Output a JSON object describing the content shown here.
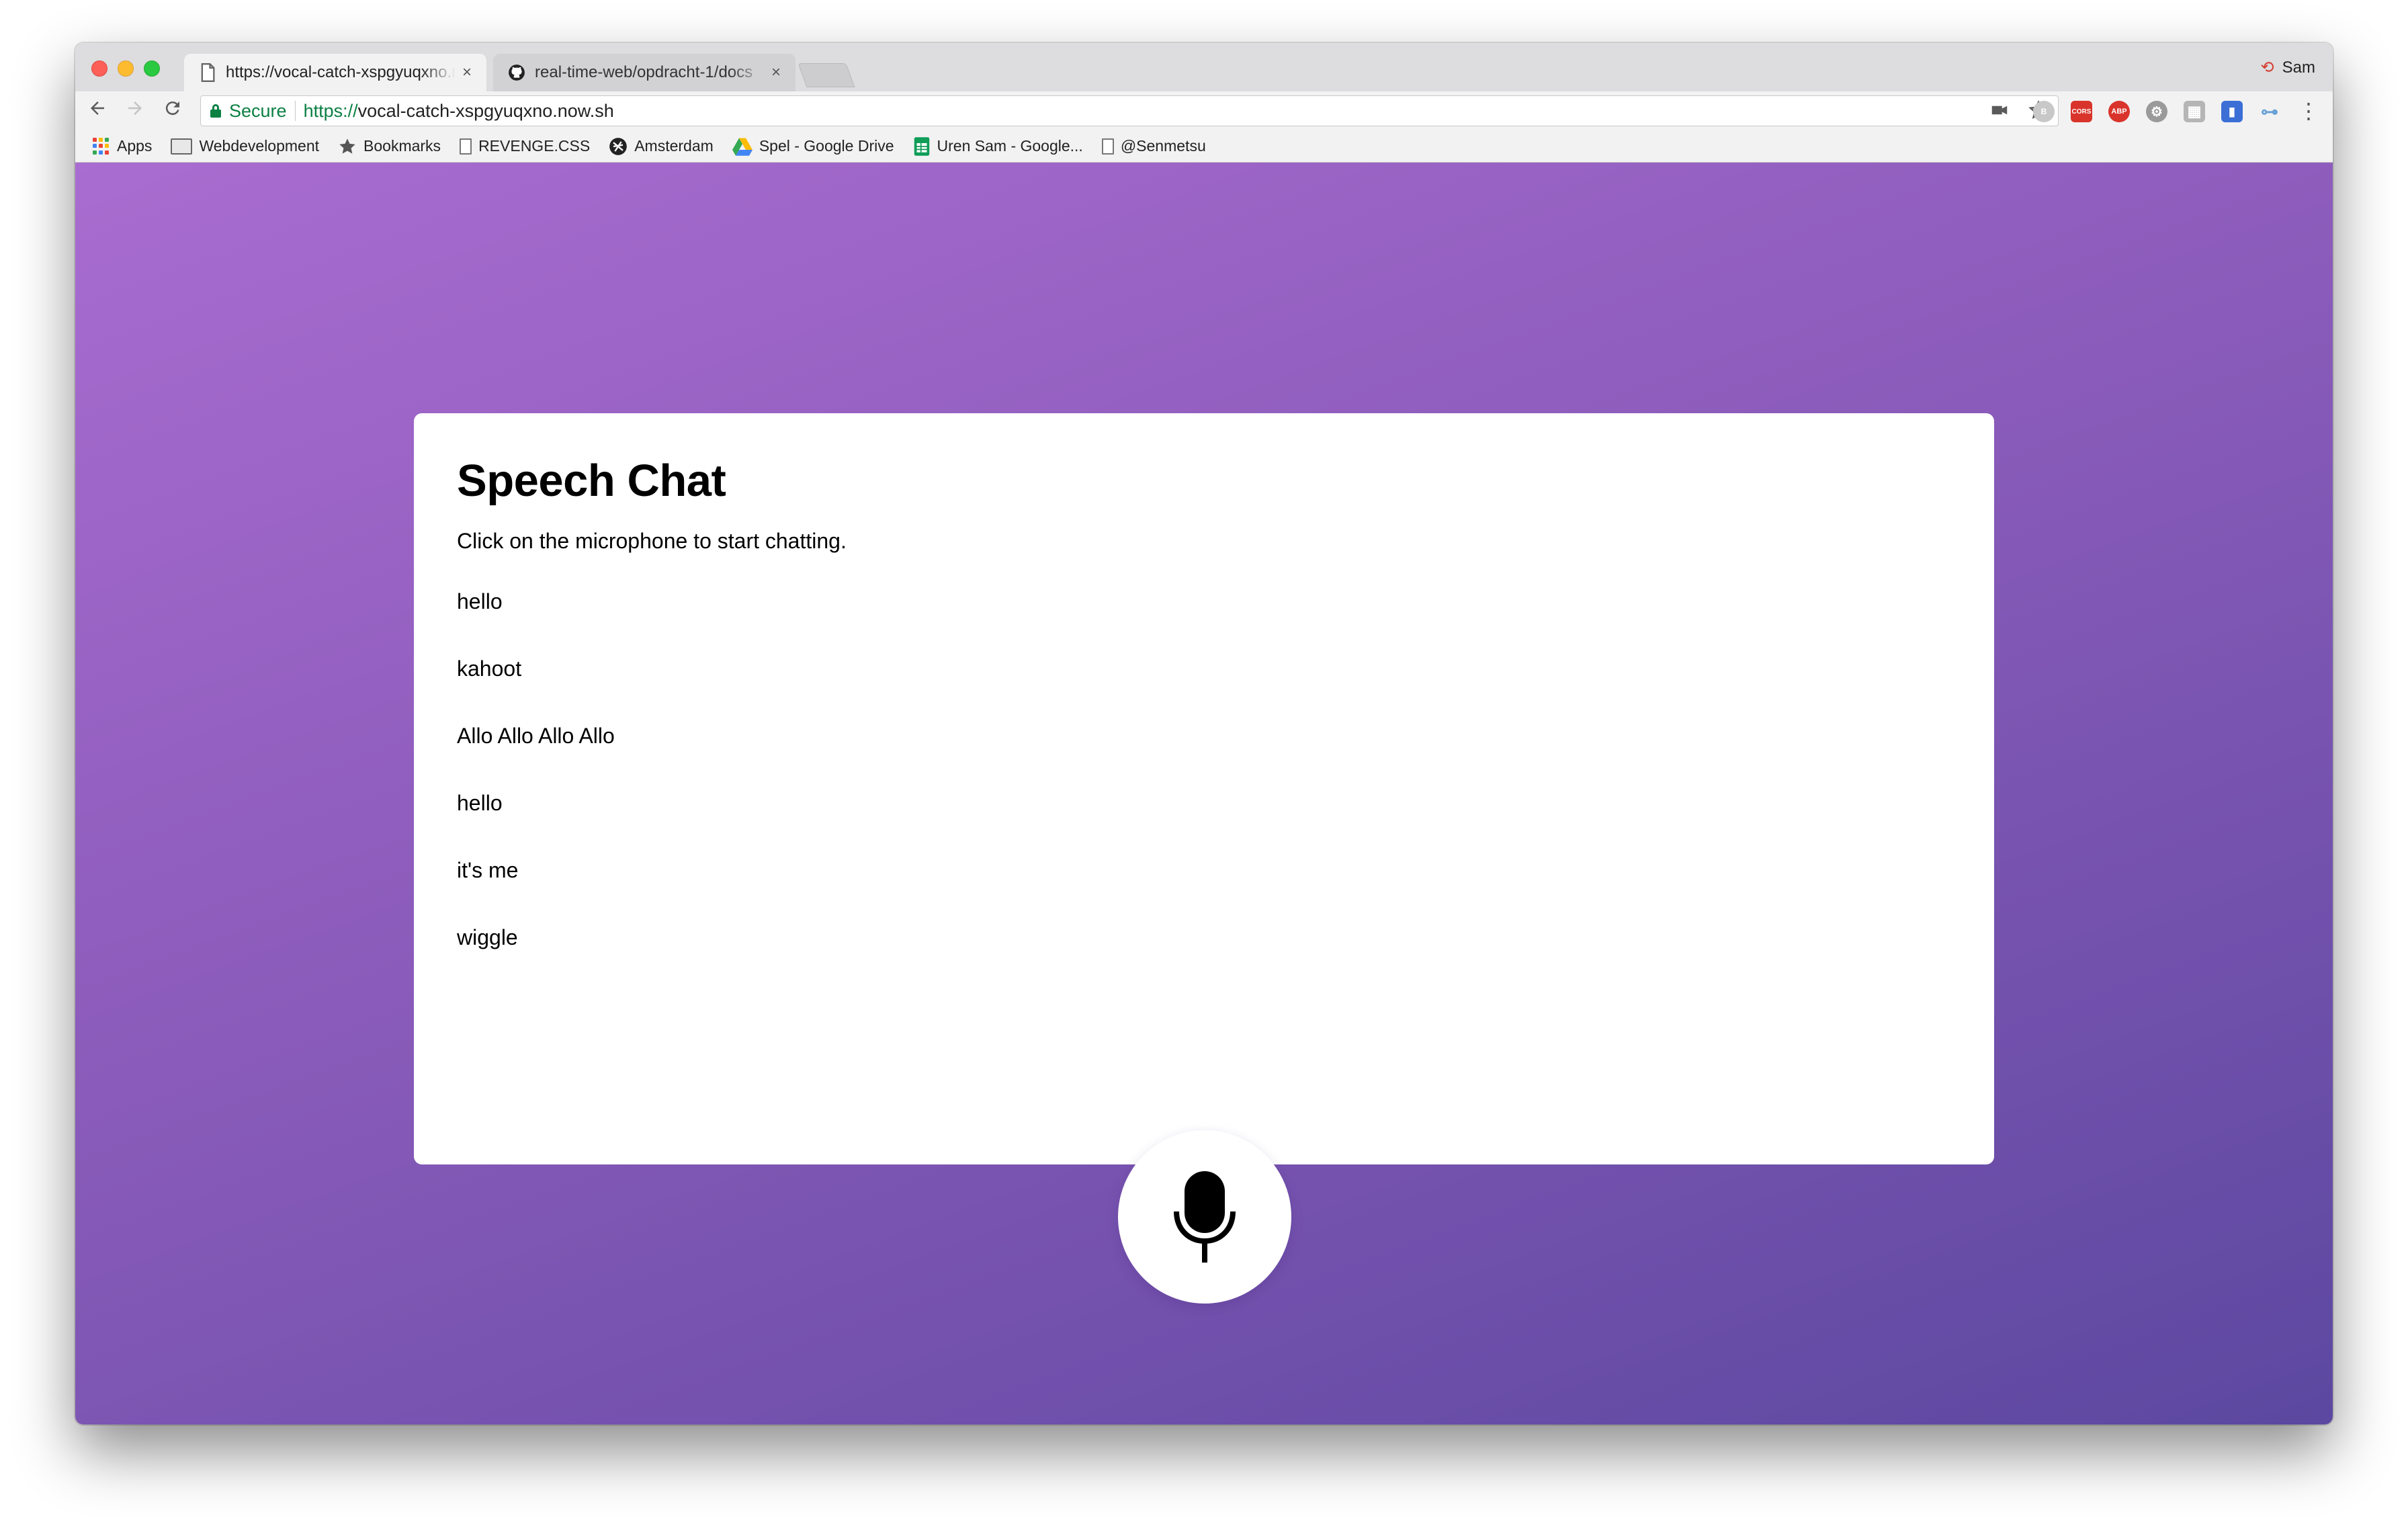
{
  "browser": {
    "tabs": [
      {
        "title": "https://vocal-catch-xspgyuqxno.now.sh",
        "active": true,
        "icon": "page-icon"
      },
      {
        "title": "real-time-web/opdracht-1/docs",
        "active": false,
        "icon": "github-icon"
      }
    ],
    "close_glyph": "×",
    "profile_name": "Sam",
    "omnibox": {
      "secure_label": "Secure",
      "url_scheme": "https://",
      "url_rest": "vocal-catch-xspgyuqxno.now.sh"
    },
    "extensions": [
      {
        "name": "bitdefender-extension-icon",
        "label": "B",
        "color": "#c8c8c8"
      },
      {
        "name": "cors-extension-icon",
        "label": "CORS",
        "color": "#d9342b"
      },
      {
        "name": "adblock-plus-icon",
        "label": "ABP",
        "color": "#d9342b"
      },
      {
        "name": "settings-extension-icon",
        "label": "⚙",
        "color": "#9a9a9a"
      },
      {
        "name": "qr-code-extension-icon",
        "label": "▦",
        "color": "#b5b5b5"
      },
      {
        "name": "blue-extension-icon",
        "label": "▮",
        "color": "#3b6fd6"
      },
      {
        "name": "toggle-extension-icon",
        "label": "⊶",
        "color": "#6aa1d6"
      }
    ],
    "bookmarks": [
      {
        "label": "Apps",
        "icon": "apps-grid-icon"
      },
      {
        "label": "Webdevelopment",
        "icon": "folder-icon"
      },
      {
        "label": "Bookmarks",
        "icon": "star-icon"
      },
      {
        "label": "REVENGE.CSS",
        "icon": "page-icon"
      },
      {
        "label": "Amsterdam",
        "icon": "amsterdam-icon"
      },
      {
        "label": "Spel - Google Drive",
        "icon": "google-drive-icon"
      },
      {
        "label": "Uren Sam - Google...",
        "icon": "google-sheets-icon"
      },
      {
        "label": "@Senmetsu",
        "icon": "page-icon"
      }
    ]
  },
  "page": {
    "title": "Speech Chat",
    "subtitle": "Click on the microphone to start chatting.",
    "messages": [
      "hello",
      "kahoot",
      "Allo Allo Allo Allo",
      "hello",
      "it's me",
      "wiggle"
    ],
    "mic_icon": "microphone-icon",
    "colors": {
      "gradient_start": "#a96cd0",
      "gradient_end": "#5c48a0",
      "card": "#ffffff",
      "secure_green": "#0b8043"
    }
  }
}
